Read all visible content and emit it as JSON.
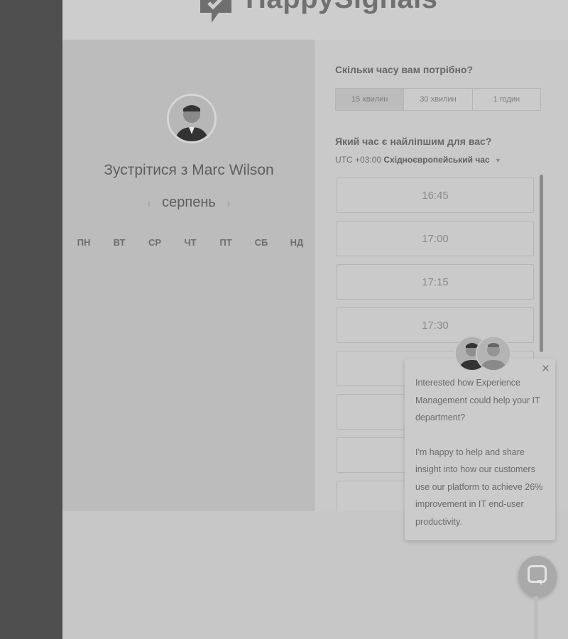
{
  "brand": {
    "name": "HappySignals"
  },
  "host": {
    "name": "Marc Wilson",
    "meet_prefix": "Зустрітися з",
    "month": "серпень",
    "weekdays": [
      "ПН",
      "ВТ",
      "СР",
      "ЧТ",
      "ПТ",
      "СБ",
      "НД"
    ]
  },
  "booking": {
    "duration_question": "Скільки часу вам потрібно?",
    "durations": [
      "15 хвилин",
      "30 хвилин",
      "1 годин"
    ],
    "time_question": "Який час є найліпшим для вас?",
    "timezone_offset": "UTC +03:00",
    "timezone_name": "Східноєвропейський час",
    "slots": [
      "16:45",
      "17:00",
      "17:15",
      "17:30",
      "",
      "",
      "",
      ""
    ]
  },
  "popup": {
    "paragraph1": "Interested how Experience Management could help your IT department?",
    "paragraph2": "I'm happy to help and share insight into how our customers use our platform to achieve 26% improvement in IT end-user productivity."
  }
}
